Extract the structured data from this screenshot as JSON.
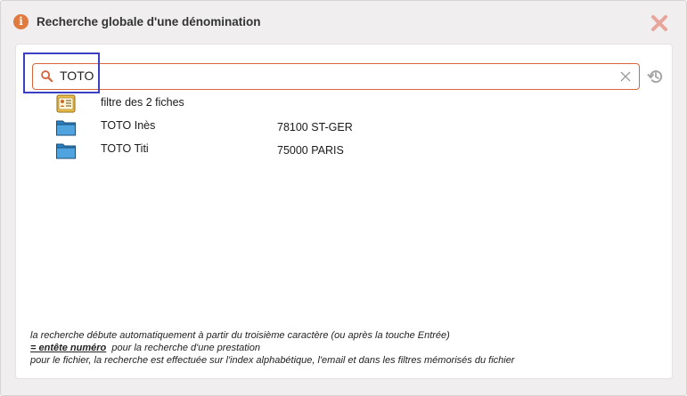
{
  "window": {
    "title": "Recherche globale d'une dénomination",
    "title_icon": "info-icon",
    "close_icon": "close-x-icon",
    "accent_color": "#e07a3f",
    "close_color": "#e8a59b"
  },
  "search": {
    "value": "TOTO",
    "search_icon": "magnifier-icon",
    "clear_icon": "clear-x-icon",
    "history_icon": "history-icon",
    "border_color": "#d8643c",
    "highlight_color": "#3a3fc4"
  },
  "results": [
    {
      "icon": "card-file-icon",
      "name": "filtre des 2 fiches",
      "city": ""
    },
    {
      "icon": "folder-icon",
      "name": "TOTO Inès",
      "city": "78100 ST-GER"
    },
    {
      "icon": "folder-icon",
      "name": "TOTO Titi",
      "city": "75000 PARIS"
    }
  ],
  "footer": {
    "line1": "la recherche débute automatiquement à partir du troisième caractère (ou après la touche Entrée)",
    "line2_strong": "= entête numéro",
    "line2_rest": "  pour la recherche d'une prestation",
    "line3": "pour le fichier, la recherche est effectuée sur l'index alphabétique, l'email et dans les filtres mémorisés du fichier"
  }
}
